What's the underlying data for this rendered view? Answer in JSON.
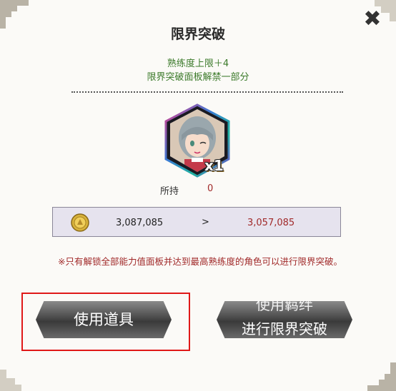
{
  "dialog": {
    "title": "限界突破",
    "subtitle_line1": "熟练度上限＋4",
    "subtitle_line2": "限界突破面板解禁一部分",
    "close_icon": "close-icon"
  },
  "item": {
    "badge": "x1",
    "hold_label": "所持",
    "hold_value": "0"
  },
  "coins": {
    "icon": "gold-coin-icon",
    "current": "3,087,085",
    "arrow": ">",
    "after": "3,057,085"
  },
  "note": "※只有解锁全部能力值面板并达到最高熟练度的角色可以进行限界突破。",
  "buttons": {
    "use_item": "使用道具",
    "bond_line1": "使用羁绊",
    "bond_line2": "进行限界突破"
  },
  "colors": {
    "accent_red": "#a12a2a",
    "accent_green": "#3b7a2a",
    "highlight": "#e01818"
  }
}
